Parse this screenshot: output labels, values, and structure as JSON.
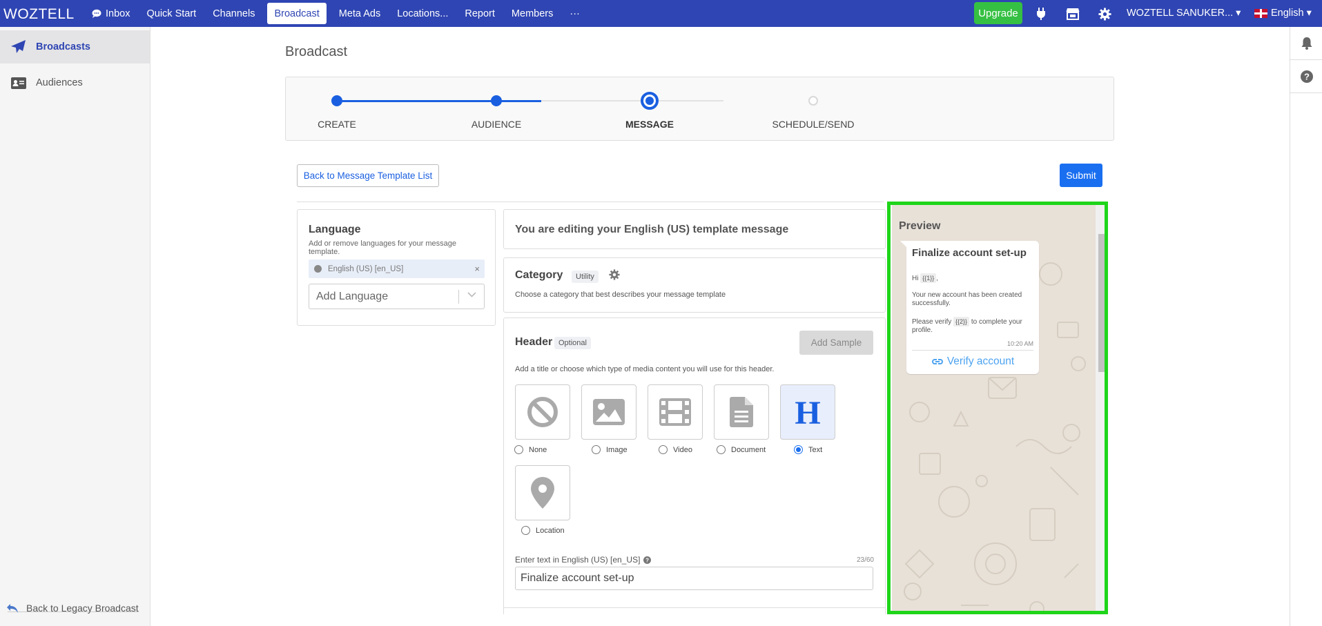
{
  "topbar": {
    "logo": "WOZTELL",
    "nav": [
      "Inbox",
      "Quick Start",
      "Channels",
      "Broadcast",
      "Meta Ads",
      "Locations...",
      "Report",
      "Members",
      "···"
    ],
    "active_nav": "Broadcast",
    "upgrade": "Upgrade",
    "account": "WOZTELL SANUKER... ▾",
    "language": "English ▾"
  },
  "sidebar": {
    "items": [
      {
        "label": "Broadcasts",
        "icon": "paper-plane-icon",
        "active": true
      },
      {
        "label": "Audiences",
        "icon": "address-card-icon",
        "active": false
      }
    ],
    "legacy": "Back to Legacy Broadcast"
  },
  "page": {
    "title": "Broadcast"
  },
  "stepper": {
    "steps": [
      "CREATE",
      "AUDIENCE",
      "MESSAGE",
      "SCHEDULE/SEND"
    ],
    "current": "MESSAGE"
  },
  "actions": {
    "back": "Back to Message Template List",
    "submit": "Submit"
  },
  "language_card": {
    "title": "Language",
    "subtitle": "Add or remove languages for your message template.",
    "selected": "English (US) [en_US]",
    "remove": "×",
    "add_placeholder": "Add Language"
  },
  "editing": {
    "title": "You are editing your English (US) template message"
  },
  "category": {
    "title": "Category",
    "tag": "Utility",
    "subtitle": "Choose a category that best describes your message template"
  },
  "header_section": {
    "title": "Header",
    "tag": "Optional",
    "add_sample": "Add Sample",
    "subtitle": "Add a title or choose which type of media content you will use for this header.",
    "media_options": [
      "None",
      "Image",
      "Video",
      "Document",
      "Text",
      "Location"
    ],
    "selected": "Text",
    "text_label": "Enter text in English (US) [en_US]",
    "text_count": "23/60",
    "text_value": "Finalize account set-up"
  },
  "preview": {
    "title": "Preview",
    "message_title": "Finalize account set-up",
    "greeting": "Hi",
    "var1": "{{1}}",
    "greeting_end": ",",
    "line2": "Your new account has been created successfully.",
    "line3_a": "Please verify",
    "var2": "{{2}}",
    "line3_b": "to complete your profile.",
    "time": "10:20 AM",
    "action": "Verify account"
  },
  "colors": {
    "topbar": "#2f45b3",
    "accent": "#1a5fe0",
    "upgrade": "#36c043",
    "highlight": "#1fd51a"
  }
}
